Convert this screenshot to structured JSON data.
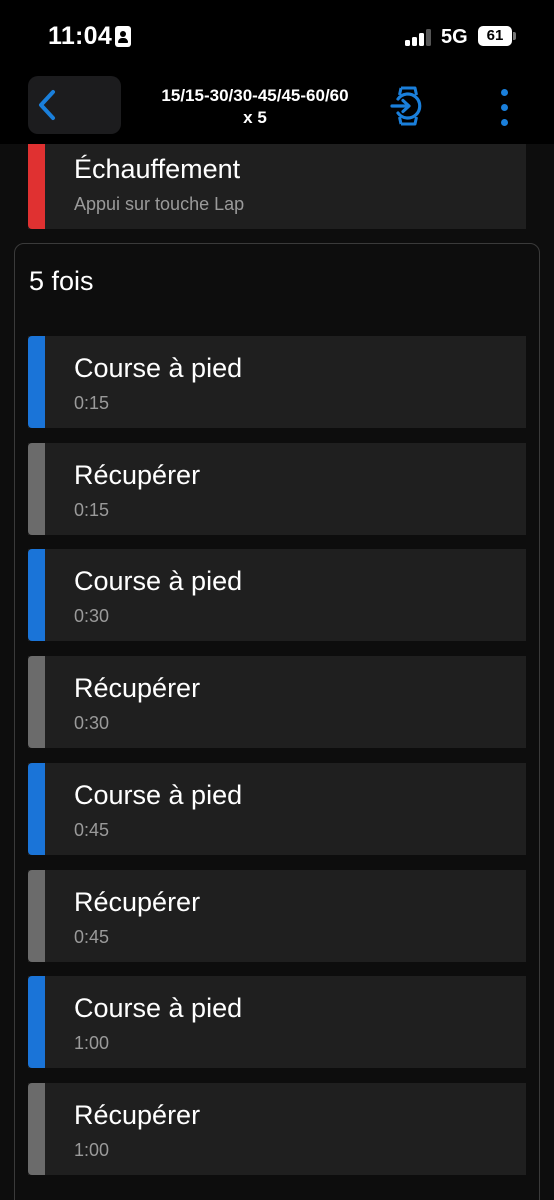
{
  "status_bar": {
    "time": "11:04",
    "network": "5G",
    "battery": "61"
  },
  "header": {
    "title_line1": "15/15-30/30-45/45-60/60",
    "title_line2": "x 5",
    "icons": {
      "back": "chevron-left-icon",
      "sync": "watch-sync-icon",
      "more": "more-vertical-icon"
    }
  },
  "colors": {
    "warmup": "#e03131",
    "run": "#1a74d8",
    "recover": "#6b6b6b",
    "accent": "#1a7fdb"
  },
  "warmup": {
    "title": "Échauffement",
    "subtitle": "Appui sur touche Lap"
  },
  "repeat": {
    "label": "5 fois",
    "steps": [
      {
        "title": "Course à pied",
        "duration": "0:15",
        "kind": "run"
      },
      {
        "title": "Récupérer",
        "duration": "0:15",
        "kind": "recover"
      },
      {
        "title": "Course à pied",
        "duration": "0:30",
        "kind": "run"
      },
      {
        "title": "Récupérer",
        "duration": "0:30",
        "kind": "recover"
      },
      {
        "title": "Course à pied",
        "duration": "0:45",
        "kind": "run"
      },
      {
        "title": "Récupérer",
        "duration": "0:45",
        "kind": "recover"
      },
      {
        "title": "Course à pied",
        "duration": "1:00",
        "kind": "run"
      },
      {
        "title": "Récupérer",
        "duration": "1:00",
        "kind": "recover"
      }
    ]
  }
}
